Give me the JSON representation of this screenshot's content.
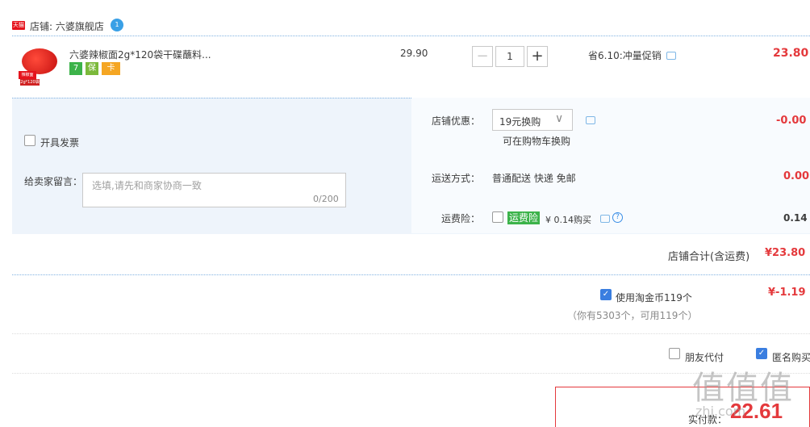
{
  "store": {
    "badge": "天猫",
    "name": "店铺: 六婆旗舰店",
    "wangwang_icon": "chat-bubble"
  },
  "item": {
    "thumb_tag": "辣椒面",
    "thumb_tag2": "2g*120袋",
    "title": "六婆辣椒面2g*120袋干碟蘸料...",
    "services": [
      "7",
      "保",
      "卡"
    ],
    "unit_price": "29.90",
    "qty_minus": "−",
    "qty": "1",
    "qty_plus": "+",
    "promo": "省6.10:冲量促销",
    "subtotal": "23.80"
  },
  "invoice": {
    "label": "开具发票"
  },
  "message": {
    "label": "给卖家留言：",
    "placeholder": "选填,请先和商家协商一致",
    "count": "0/200"
  },
  "shop_discount": {
    "label": "店铺优惠：",
    "selected": "19元换购",
    "arrow": "∨",
    "tip": "可在购物车换购",
    "value": "-0.00"
  },
  "shipping": {
    "label": "运送方式：",
    "value": "普通配送 快递 免邮",
    "cost": "0.00"
  },
  "insurance": {
    "label": "运费险：",
    "tag": "运费险",
    "price": "¥ 0.14购买",
    "help": "?",
    "value": "0.14"
  },
  "store_total": {
    "label": "店铺合计(含运费)",
    "value": "¥23.80"
  },
  "coins": {
    "label": "使用淘金币119个",
    "sub": "（你有5303个，可用119个）",
    "value": "¥-1.19",
    "checked": true
  },
  "options": {
    "friend_pay": "朋友代付",
    "anonymous": "匿名购买",
    "anonymous_checked": true
  },
  "payment": {
    "label": "实付款：",
    "value": "22.61"
  },
  "watermark": {
    "main": "值值值",
    "sub": "zhi.com"
  },
  "colors": {
    "accent_red": "#e4393c",
    "blue_check": "#3a7ee0",
    "panel_bg": "#eef4fb"
  }
}
